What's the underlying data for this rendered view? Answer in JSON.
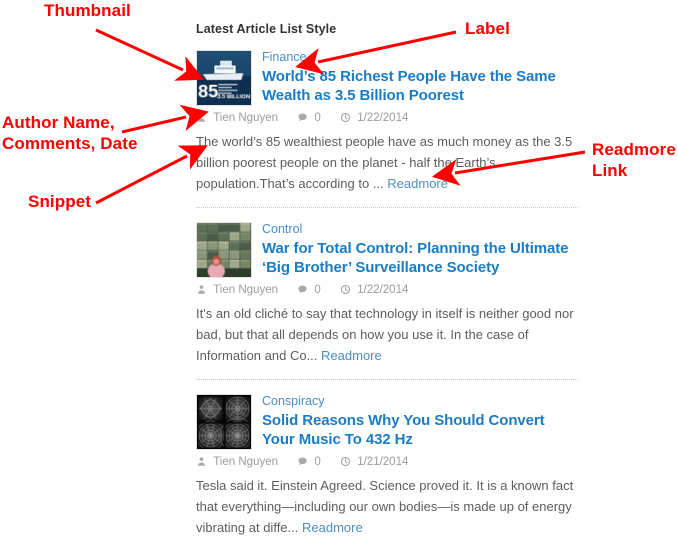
{
  "heading": "Latest Article List Style",
  "colors": {
    "annotation": "#ff0000",
    "category": "#4a8fc0",
    "title": "#1a7cc4",
    "meta": "#9b9b9b",
    "snippet": "#5d5d5d",
    "link": "#4a8fc0",
    "divider": "#c9c9c9"
  },
  "annotations": [
    {
      "id": "thumbnail",
      "text": "Thumbnail"
    },
    {
      "id": "author",
      "text": "Author Name,\nComments, Date"
    },
    {
      "id": "snippet",
      "text": "Snippet"
    },
    {
      "id": "label",
      "text": "Label"
    },
    {
      "id": "readmore",
      "text": "Readmore\nLink"
    }
  ],
  "articles": [
    {
      "category": "Finance",
      "title": "World’s 85 Richest People Have the Same Wealth as 3.5 Billion Poorest",
      "author": "Tien Nguyen",
      "comments": "0",
      "date": "1/22/2014",
      "snippet": "The world’s 85 wealthiest people have as much money as the 3.5 billion poorest people on the planet - half the Earth’s population.That’s according to ...",
      "readmore": "Readmore",
      "thumb_alt": "yacht-85-richest-people-thumbnail"
    },
    {
      "category": "Control",
      "title": "War for Total Control: Planning the Ultimate ‘Big Brother’ Surveillance Society",
      "author": "Tien Nguyen",
      "comments": "0",
      "date": "1/22/2014",
      "snippet": "It's an old cliché to say that technology in itself is neither good nor bad, but that all depends on how you use it. In the case of Information and Co...",
      "readmore": "Readmore",
      "thumb_alt": "surveillance-monitors-thumbnail"
    },
    {
      "category": "Conspiracy",
      "title": "Solid Reasons Why You Should Convert Your Music To 432 Hz",
      "author": "Tien Nguyen",
      "comments": "0",
      "date": "1/21/2014",
      "snippet": "Tesla said it. Einstein Agreed. Science proved it. It is a known fact that everything—including our own bodies—is made up of energy vibrating at diffe...",
      "readmore": "Readmore",
      "thumb_alt": "dark-ornamental-tiles-thumbnail"
    }
  ],
  "icons": {
    "author": "user-icon",
    "comments": "comment-bubble-icon",
    "date": "clock-icon"
  }
}
